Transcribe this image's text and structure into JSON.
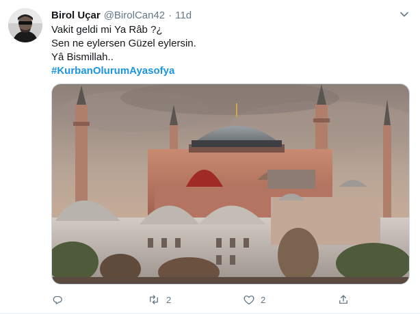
{
  "tweet": {
    "author": {
      "display_name": "Birol Uçar",
      "handle": "@BirolCan42",
      "separator": "·",
      "time": "11d",
      "avatar_icon": "profile-photo"
    },
    "text_lines": [
      "Vakit geldi mi Ya Râb ?¿",
      "Sen ne eylersen Güzel eylersin.",
      "Yâ Bismillah.."
    ],
    "hashtag": "#KurbanOlurumAyasofya",
    "media": {
      "icon": "hagia-sophia-photo"
    },
    "actions": {
      "reply": {
        "icon": "reply-icon",
        "count": ""
      },
      "retweet": {
        "icon": "retweet-icon",
        "count": "2"
      },
      "like": {
        "icon": "heart-icon",
        "count": "2"
      },
      "share": {
        "icon": "share-icon",
        "count": ""
      }
    },
    "colors": {
      "link": "#1b95e0",
      "muted": "#657786",
      "text": "#14171a"
    }
  }
}
